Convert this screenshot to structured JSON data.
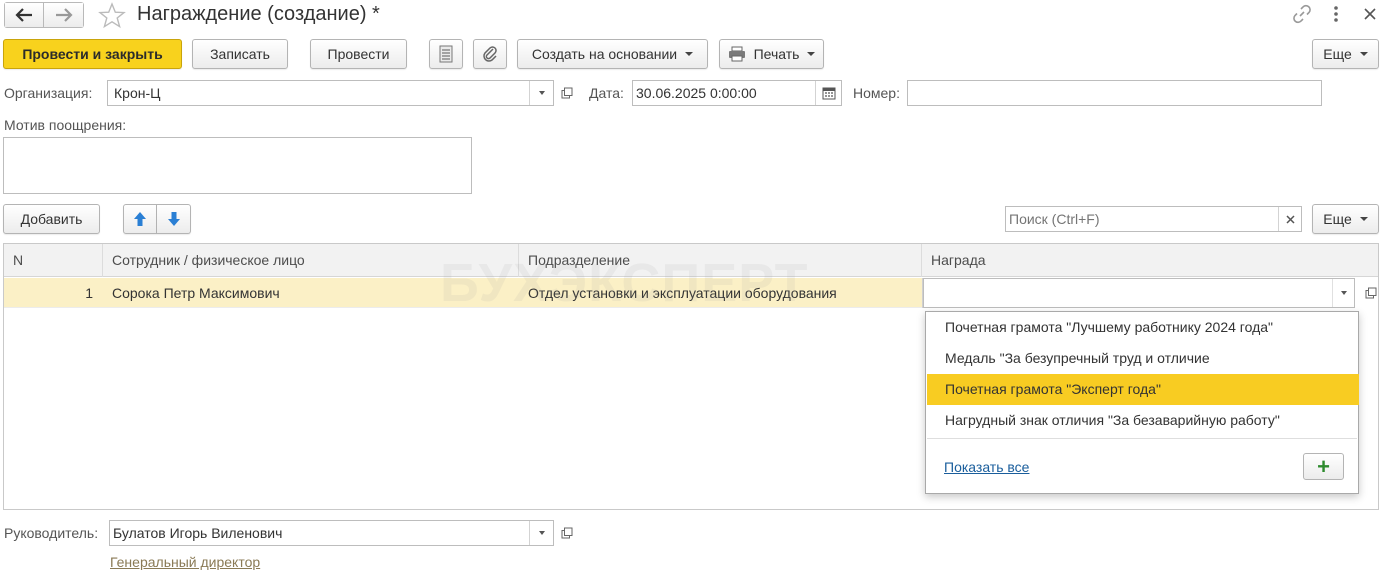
{
  "window": {
    "title": "Награждение (создание) *"
  },
  "toolbar": {
    "post_close": "Провести и закрыть",
    "save": "Записать",
    "post": "Провести",
    "create_based": "Создать на основании",
    "print": "Печать",
    "more": "Еще"
  },
  "header": {
    "org_label": "Организация:",
    "org_value": "Крон-Ц",
    "date_label": "Дата:",
    "date_value": "30.06.2025  0:00:00",
    "number_label": "Номер:",
    "number_value": "",
    "motive_label": "Мотив поощрения:",
    "motive_value": ""
  },
  "table_toolbar": {
    "add": "Добавить",
    "search_placeholder": "Поиск (Ctrl+F)",
    "more": "Еще"
  },
  "table": {
    "columns": [
      "N",
      "Сотрудник / физическое лицо",
      "Подразделение",
      "Награда"
    ],
    "rows": [
      {
        "n": "1",
        "employee": "Сорока Петр Максимович",
        "department": "Отдел установки и эксплуатации оборудования",
        "award": ""
      }
    ]
  },
  "watermark": "БУХЭКСПЕРТ",
  "award_dropdown": {
    "items": [
      "Почетная грамота \"Лучшему работнику 2024 года\"",
      "Медаль \"За безупречный труд и отличие",
      "Почетная грамота \"Эксперт года\"",
      "Нагрудный знак отличия \"За безаварийную работу\""
    ],
    "selected_index": 2,
    "show_all": "Показать все",
    "add_symbol": "+"
  },
  "footer": {
    "manager_label": "Руководитель:",
    "manager_value": "Булатов Игорь Виленович",
    "manager_position": "Генеральный директор"
  },
  "colors": {
    "accent": "#f8d21d",
    "row_highlight": "#fbf0c6",
    "selected_item": "#f8cc22",
    "link": "#1a5e9c"
  }
}
